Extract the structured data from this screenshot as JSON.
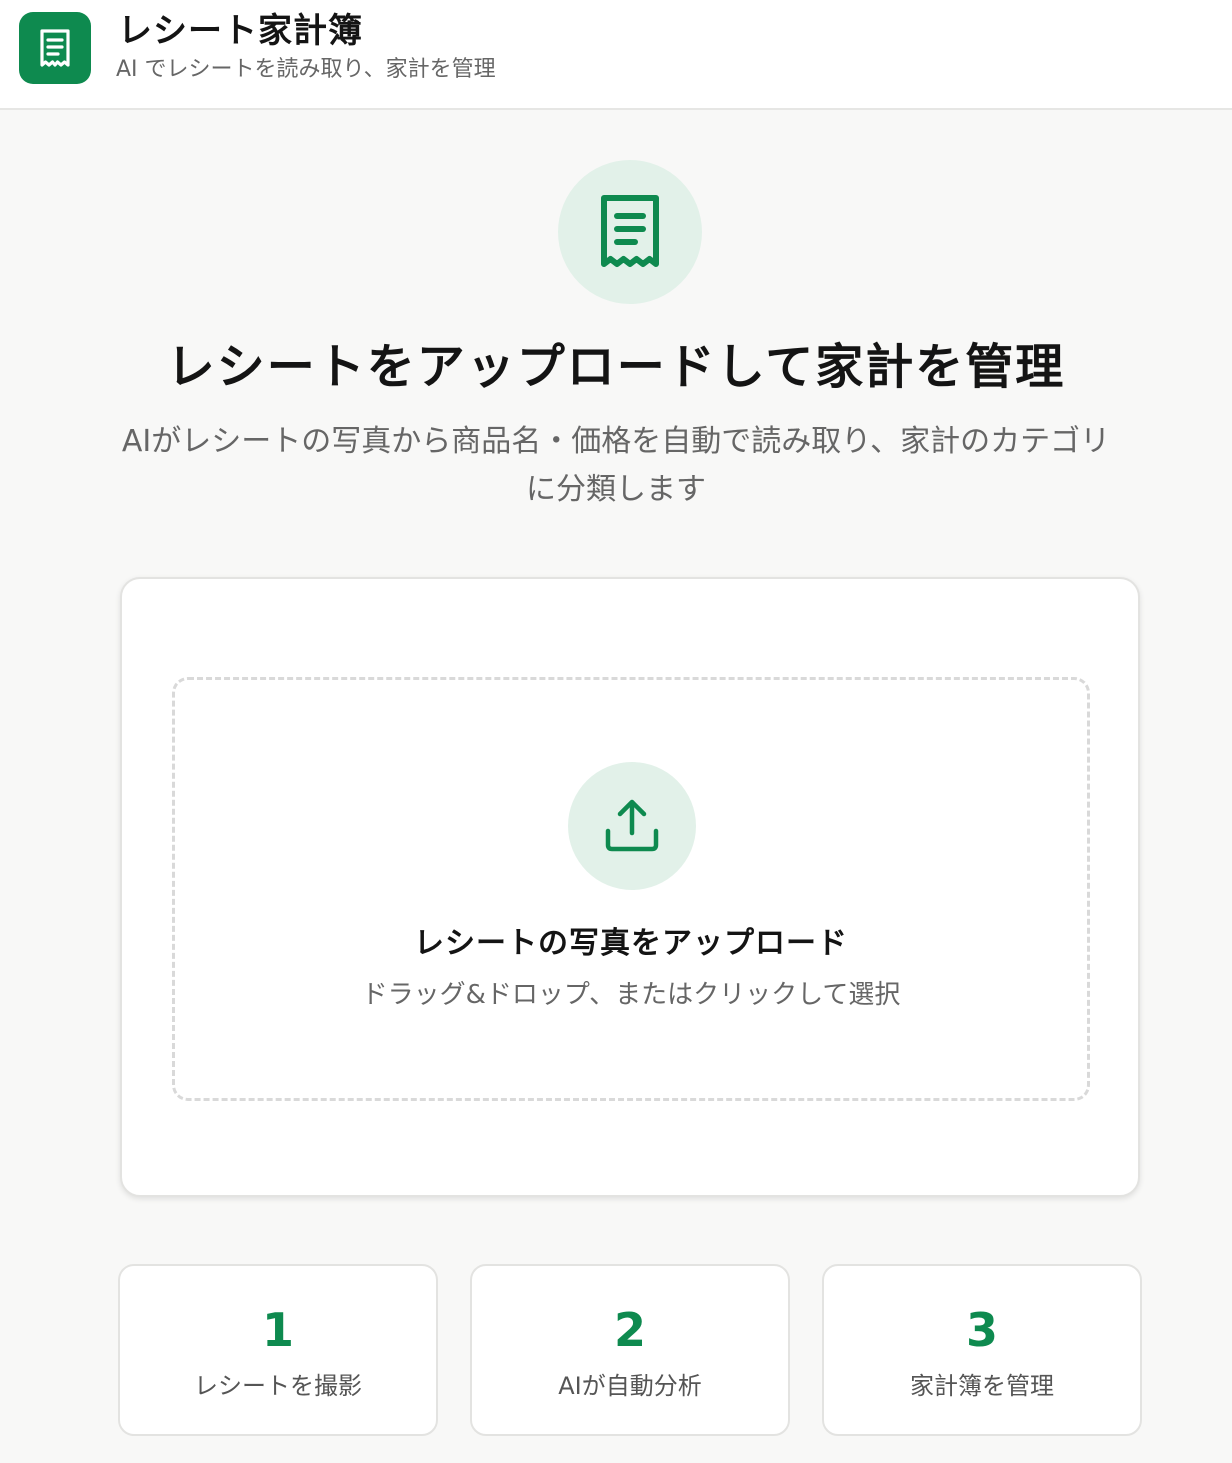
{
  "header": {
    "title": "レシート家計簿",
    "subtitle": "AI でレシートを読み取り、家計を管理",
    "logo_icon": "receipt-icon"
  },
  "hero": {
    "icon": "receipt-icon",
    "title": "レシートをアップロードして家計を管理",
    "description": "AIがレシートの写真から商品名・価格を自動で読み取り、家計のカテゴリに分類します"
  },
  "upload": {
    "icon": "upload-icon",
    "title": "レシートの写真をアップロード",
    "hint": "ドラッグ&ドロップ、またはクリックして選択"
  },
  "steps": [
    {
      "number": "1",
      "label": "レシートを撮影"
    },
    {
      "number": "2",
      "label": "AIが自動分析"
    },
    {
      "number": "3",
      "label": "家計簿を管理"
    }
  ],
  "colors": {
    "accent": "#0e8a4f",
    "accent_light": "#e2f1e9",
    "background": "#f8f8f7"
  }
}
